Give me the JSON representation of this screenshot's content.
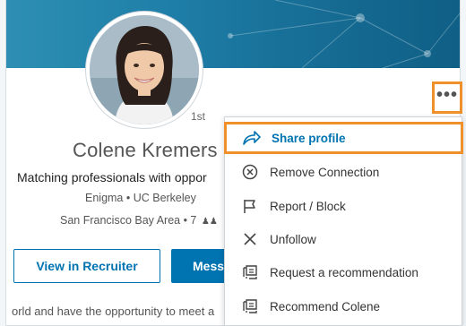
{
  "profile": {
    "degree": "1st",
    "name": "Colene Kremers",
    "headline": "Matching professionals with oppor",
    "education": "Enigma • UC Berkeley",
    "location": "San Francisco Bay Area • 7",
    "connections_icon": "people-icon",
    "bio_snippet": "orld and have the opportunity to meet a"
  },
  "actions": {
    "recruiter_label": "View in Recruiter",
    "message_label": "Messa",
    "more_label": "•••"
  },
  "menu": {
    "items": [
      {
        "label": "Share profile",
        "icon": "share-arrow-icon"
      },
      {
        "label": "Remove Connection",
        "icon": "remove-circle-x-icon"
      },
      {
        "label": "Report / Block",
        "icon": "flag-icon"
      },
      {
        "label": "Unfollow",
        "icon": "x-icon"
      },
      {
        "label": "Request a recommendation",
        "icon": "recommendation-icon"
      },
      {
        "label": "Recommend Colene",
        "icon": "recommendation-icon"
      }
    ]
  },
  "colors": {
    "brand_blue": "#0073b1",
    "highlight_orange": "#f0902a",
    "banner_blue": "#1f7fa8"
  }
}
